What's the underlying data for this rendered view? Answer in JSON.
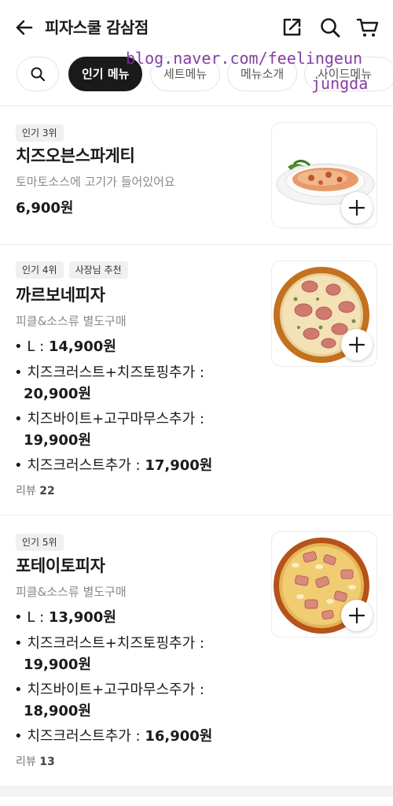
{
  "header": {
    "title": "피자스쿨 감삼점",
    "back_icon": "arrow-left-icon",
    "share_icon": "share-icon",
    "search_icon": "search-icon",
    "cart_icon": "cart-icon"
  },
  "tabs": {
    "search_icon": "search-icon",
    "items": [
      "인기 메뉴",
      "세트메뉴",
      "메뉴소개",
      "사이드메뉴"
    ],
    "active": "인기 메뉴"
  },
  "watermark": {
    "line1": "blog.naver.com/feelingeun",
    "line2": "jungda"
  },
  "items": [
    {
      "badges": [
        "인기 3위"
      ],
      "name": "치즈오븐스파게티",
      "desc": "토마토소스에 고기가 들어있어요",
      "price": "6,900원"
    },
    {
      "badges": [
        "인기 4위",
        "사장님 추천"
      ],
      "name": "까르보네피자",
      "desc": "피클&소스류 별도구매",
      "options": [
        {
          "label": "• L : ",
          "price": "14,900원"
        },
        {
          "label": "• 치즈크러스트+치즈토핑추가 :",
          "price": "20,900원"
        },
        {
          "label": "• 치즈바이트+고구마무스추가 :",
          "price": "19,900원"
        },
        {
          "label": "• 치즈크러스트추가 : ",
          "price": "17,900원"
        }
      ],
      "review_label": "리뷰",
      "review_count": "22"
    },
    {
      "badges": [
        "인기 5위"
      ],
      "name": "포테이토피자",
      "desc": "피클&소스류 별도구매",
      "options": [
        {
          "label": "• L : ",
          "price": "13,900원"
        },
        {
          "label": "• 치즈크러스트+치즈토핑추가 :",
          "price": "19,900원"
        },
        {
          "label": "• 치즈바이트+고구마무스주가 :",
          "price": "18,900원"
        },
        {
          "label": "• 치즈크러스트추가 : ",
          "price": "16,900원"
        }
      ],
      "review_label": "리뷰",
      "review_count": "13"
    }
  ],
  "colors": {
    "accent_dark": "#1a1a1a",
    "watermark": "#7b2f9e",
    "muted": "#8a8a8a"
  }
}
